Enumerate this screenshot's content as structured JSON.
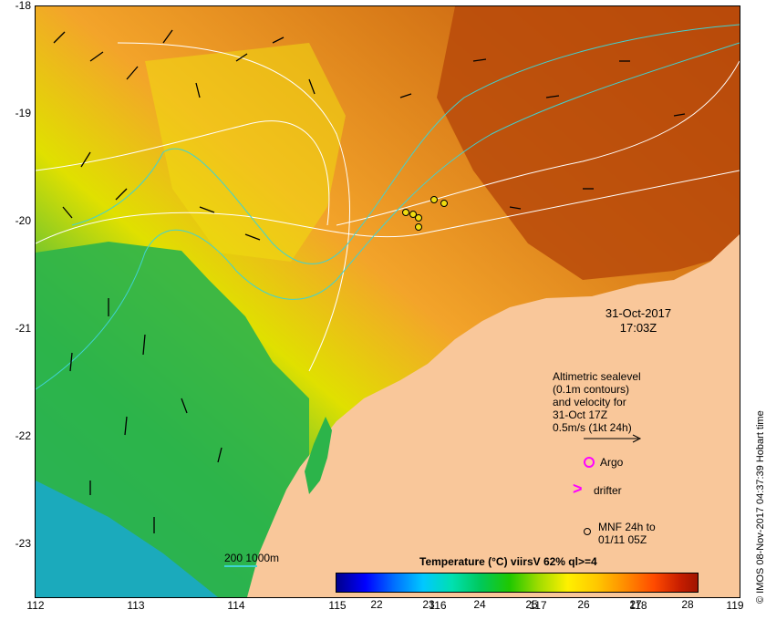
{
  "map": {
    "y_ticks": [
      "-18",
      "-19",
      "-20",
      "-21",
      "-22",
      "-23"
    ],
    "x_ticks": [
      "112",
      "113",
      "114",
      "115",
      "116",
      "117",
      "118",
      "119"
    ],
    "lon_range": [
      112,
      119
    ],
    "lat_range": [
      -23.5,
      -18
    ],
    "colors": {
      "land": "#f9c79a",
      "warm_sea": "#b84a0a",
      "mid_sea": "#f3a42a",
      "cool_sea": "#2cb44a",
      "cold_sea": "#1aa8c8",
      "contour": "#ffffff",
      "isobath": "#3fd3d3",
      "arrows": "#000000"
    }
  },
  "datetime": {
    "date": "31-Oct-2017",
    "time": "17:03Z"
  },
  "legend": {
    "line1": "Altimetric sealevel",
    "line2": "(0.1m contours)",
    "line3": "and velocity for",
    "line4": "31-Oct 17Z",
    "line5": "0.5m/s (1kt 24h)",
    "argo_label": "Argo",
    "drifter_label": "drifter",
    "mnf_label_1": "MNF 24h to",
    "mnf_label_2": "01/11 05Z"
  },
  "colorbar": {
    "title": "Temperature (°C) viirsV 62% ql>=4",
    "ticks": [
      "22",
      "23",
      "24",
      "25",
      "26",
      "27",
      "28"
    ],
    "range": [
      21.5,
      28.5
    ]
  },
  "isobath_legend": "200  1000m",
  "credit": "© IMOS 08-Nov-2017 04:37:39 Hobart time"
}
